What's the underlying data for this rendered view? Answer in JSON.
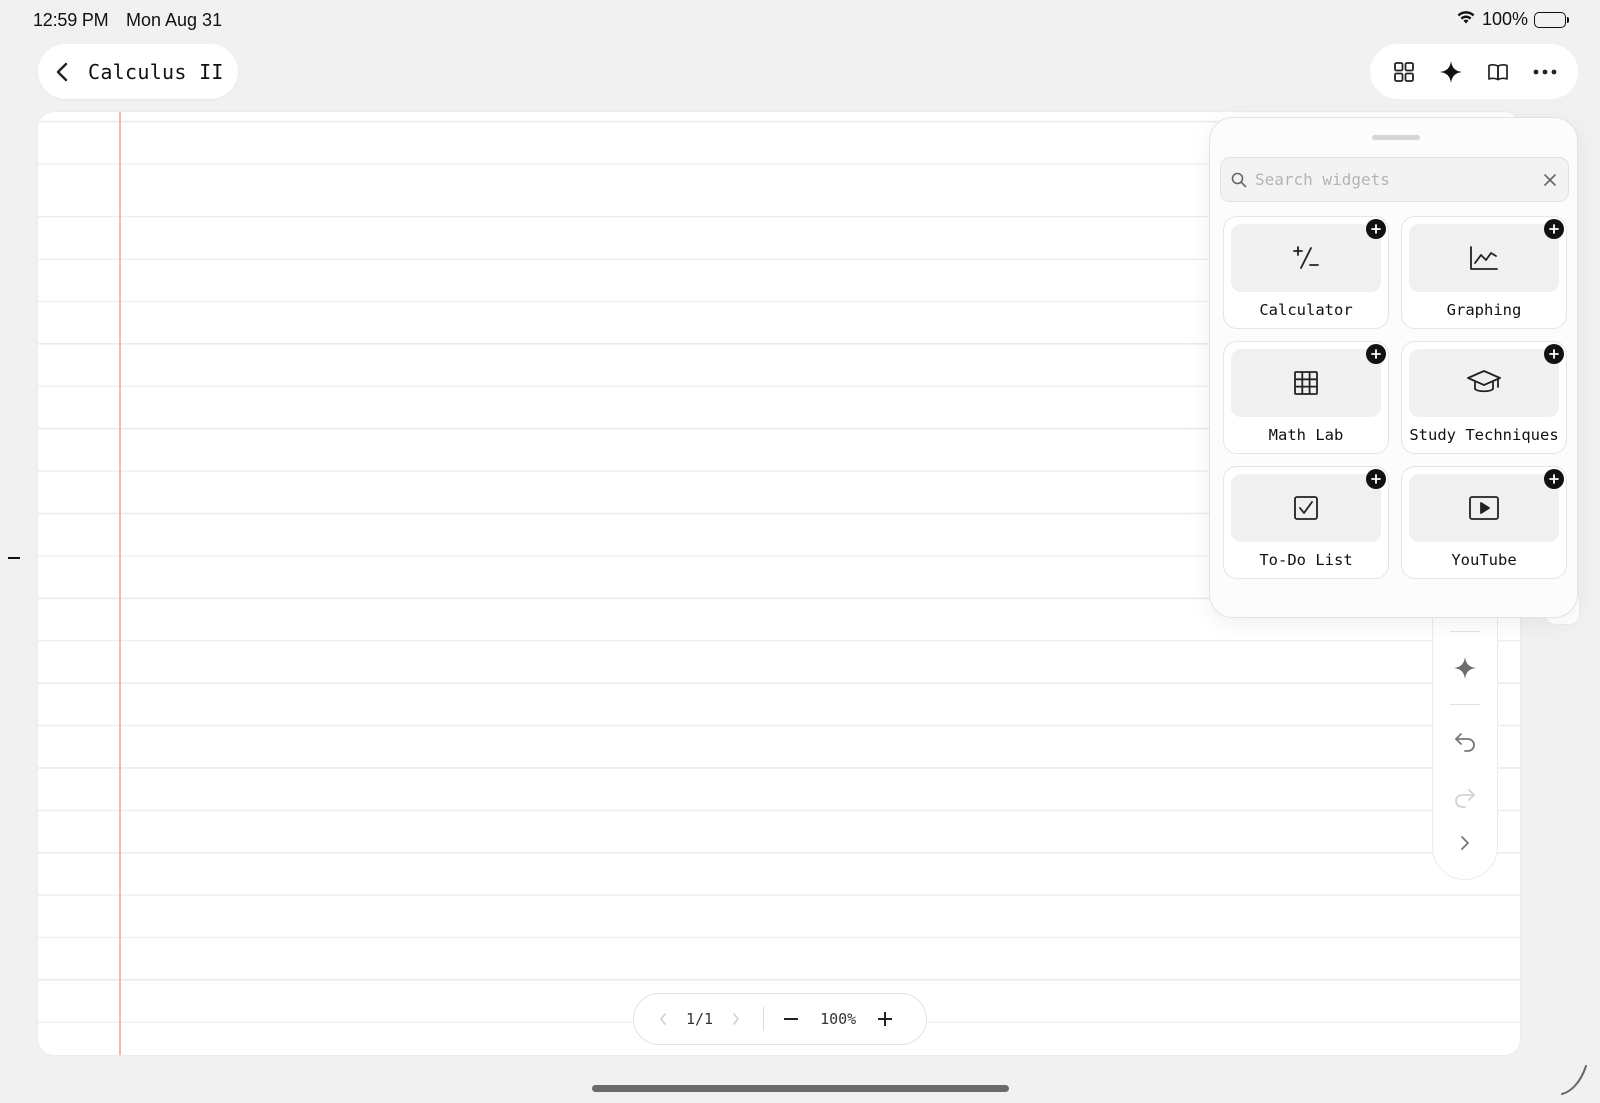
{
  "status_bar": {
    "time": "12:59 PM",
    "date": "Mon Aug 31",
    "battery": "100%"
  },
  "header": {
    "title": "Calculus II",
    "back_icon": "chevron-left-icon",
    "toolbar": [
      {
        "name": "widgets",
        "icon": "grid-icon"
      },
      {
        "name": "ai",
        "icon": "sparkle-icon"
      },
      {
        "name": "read",
        "icon": "book-icon"
      },
      {
        "name": "more",
        "icon": "ellipsis-icon"
      }
    ]
  },
  "widget_panel": {
    "search_placeholder": "Search widgets",
    "widgets": [
      {
        "label": "Calculator",
        "icon": "plus-minus-icon"
      },
      {
        "label": "Graphing",
        "icon": "line-chart-icon"
      },
      {
        "label": "Math Lab",
        "icon": "table-grid-icon"
      },
      {
        "label": "Study Techniques",
        "icon": "graduation-cap-icon"
      },
      {
        "label": "To-Do List",
        "icon": "checkbox-icon"
      },
      {
        "label": "YouTube",
        "icon": "play-icon"
      }
    ]
  },
  "page_controls": {
    "page": "1/1",
    "zoom": "100%"
  },
  "colors": {
    "background": "#f1f1f1",
    "paper": "#ffffff",
    "margin_line": "#f2b8b8",
    "rule_line": "#ececec",
    "accent": "#111111"
  }
}
